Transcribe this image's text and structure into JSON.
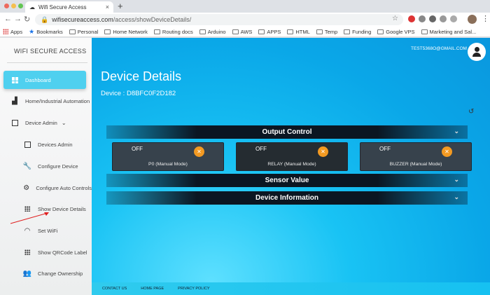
{
  "browser": {
    "tab_title": "Wifi Secure Access",
    "tab_close": "×",
    "new_tab": "+",
    "url_domain": "wifisecureaccess.com",
    "url_path": "/access/showDeviceDetails/",
    "bookmarks": [
      "Apps",
      "Bookmarks",
      "Personal",
      "Home Network",
      "Routing docs",
      "Arduino",
      "AWS",
      "APPS",
      "HTML",
      "Temp",
      "Funding",
      "Google VPS",
      "Marketing and Sal..."
    ]
  },
  "sidebar": {
    "brand": "WIFI SECURE ACCESS",
    "items": [
      {
        "label": "Dashboard"
      },
      {
        "label": "Home/Industrial Automation"
      },
      {
        "label": "Device Admin"
      },
      {
        "label": "Devices Admin"
      },
      {
        "label": "Configure Device"
      },
      {
        "label": "Configure Auto Controls"
      },
      {
        "label": "Show Device Details"
      },
      {
        "label": "Set WiFi"
      },
      {
        "label": "Show QRCode Label"
      },
      {
        "label": "Change Ownership"
      }
    ]
  },
  "header": {
    "email": "TEST5368O@GMAIL.COM"
  },
  "main": {
    "title": "Device Details",
    "device_line": "Device : D8BFC0F2D182",
    "sections": {
      "output": "Output Control",
      "sensor": "Sensor Value",
      "info": "Device Information"
    },
    "outputs": [
      {
        "state": "OFF",
        "label": "P0 (Manual Mode)"
      },
      {
        "state": "OFF",
        "label": "RELAY (Manual Mode)"
      },
      {
        "state": "OFF",
        "label": "BUZZER (Manual Mode)"
      }
    ]
  },
  "footer": {
    "contact": "CONTACT US",
    "home": "HOME PAGE",
    "privacy": "PRIVACY POLICY"
  },
  "colors": {
    "accent": "#4fd0ef",
    "toggle": "#f39a22",
    "section_bar": "#0b1622"
  }
}
